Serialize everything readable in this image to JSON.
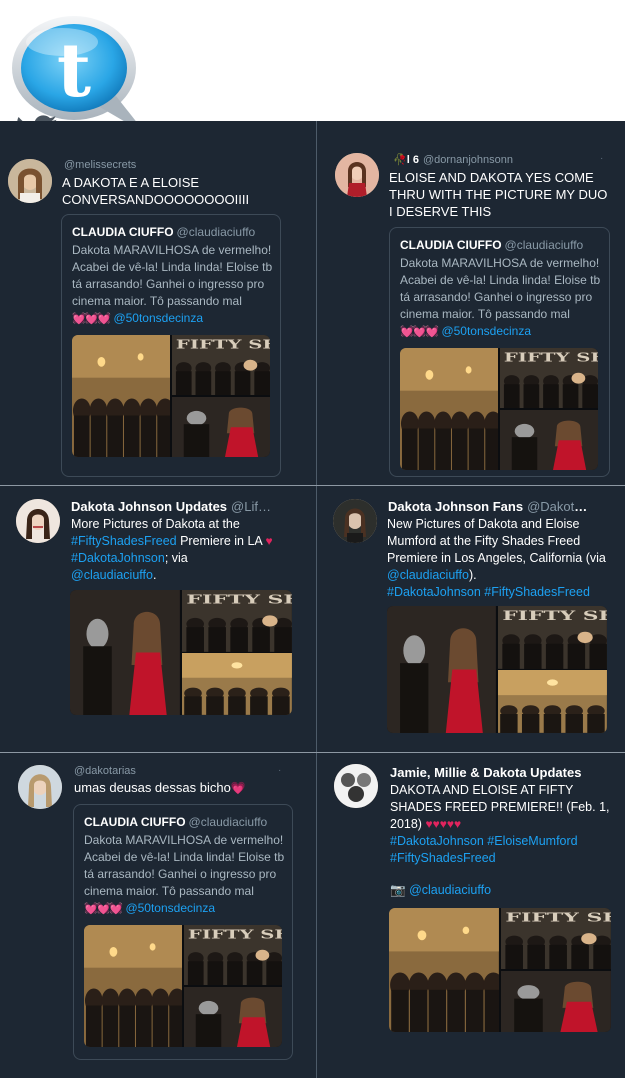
{
  "logo": {
    "icon": "twitter-bird-speech-bubble-logo",
    "glyph": "t"
  },
  "tweets": [
    {
      "handle": "@melissecrets",
      "text": "A DAKOTA E A ELOISE CONVERSANDOOOOOOOOIIII",
      "quote": {
        "name": "CLAUDIA CIUFFO",
        "handle": "@claudiaciuffo",
        "text": "Dakota MARAVILHOSA de vermelho! Acabei de vê-la! Linda linda! Eloise tb tá arrasando! Ganhei o ingresso pro cinema maior. Tô passando mal",
        "emoji": "💓💓💓",
        "mention": "@50tonsdecinza"
      }
    },
    {
      "name_prefix": "🥀",
      "name": "l 6",
      "handle": "@dornanjohnsonn",
      "text": "ELOISE AND DAKOTA YES COME THRU WITH THE PICTURE MY DUO I DESERVE THIS",
      "quote": {
        "name": "CLAUDIA CIUFFO",
        "handle": "@claudiaciuffo",
        "text": "Dakota MARAVILHOSA de vermelho! Acabei de vê-la! Linda linda! Eloise tb tá arrasando! Ganhei o ingresso pro cinema maior. Tô passando mal",
        "emoji": "💓💓💓",
        "mention": "@50tonsdecinza"
      }
    },
    {
      "name": "Dakota Johnson Updates",
      "handle": "@Lif…",
      "text_1": "More Pictures of Dakota at the ",
      "hashtag_1": "#FiftyShadesFreed",
      "text_2": " Premiere in LA ",
      "heart": "♥",
      "hashtag_2": " #DakotaJohnson",
      "text_3": "; via ",
      "mention": "@claudiaciuffo",
      "text_4": "."
    },
    {
      "name": "Dakota Johnson Fans",
      "handle": "@Dakota…",
      "text_1": "New Pictures of Dakota and Eloise Mumford at the Fifty Shades Freed Premiere in Los Angeles, California (via ",
      "mention": "@claudiaciuffo",
      "text_2": ").",
      "hashtags": "#DakotaJohnson #FiftyShadesFreed"
    },
    {
      "handle": "@dakotarias",
      "text": "umas deusas dessas bicho",
      "emoji": "💗",
      "quote": {
        "name": "CLAUDIA CIUFFO",
        "handle": "@claudiaciuffo",
        "text": "Dakota MARAVILHOSA de vermelho! Acabei de vê-la! Linda linda! Eloise tb tá arrasando! Ganhei o ingresso pro cinema maior. Tô passando mal",
        "emoji": "💓💓💓",
        "mention": "@50tonsdecinza"
      }
    },
    {
      "name": "Jamie, Millie & Dakota Updates",
      "text_1": "DAKOTA AND ELOISE AT FIFTY SHADES FREED PREMIERE!! (Feb. 1, 2018) ",
      "hearts": "♥♥♥♥♥",
      "hashtags": "#DakotaJohnson #EloiseMumford #FiftyShadesFreed",
      "camera": "📷",
      "mention": "@claudiaciuffo"
    }
  ],
  "photo_sign": "FIFTY SH",
  "colors": {
    "panel": "#1d2733",
    "link": "#1da1f2",
    "heart": "#e0245e",
    "dress": "#c0142a"
  }
}
